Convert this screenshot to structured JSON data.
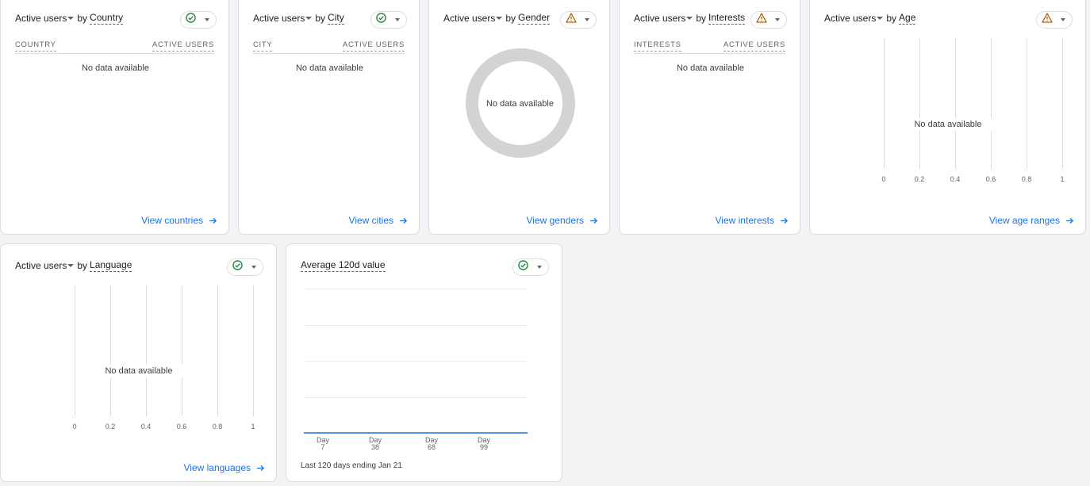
{
  "cards": {
    "country": {
      "metric": "Active users",
      "by": "by",
      "dimension": "Country",
      "status": "ok",
      "col_left": "COUNTRY",
      "col_right": "ACTIVE USERS",
      "empty": "No data available",
      "link": "View countries"
    },
    "city": {
      "metric": "Active users",
      "by": "by",
      "dimension": "City",
      "status": "ok",
      "col_left": "CITY",
      "col_right": "ACTIVE USERS",
      "empty": "No data available",
      "link": "View cities"
    },
    "gender": {
      "metric": "Active users",
      "by": "by",
      "dimension": "Gender",
      "status": "warning",
      "empty": "No data available",
      "link": "View genders"
    },
    "interests": {
      "metric": "Active users",
      "by": "by",
      "dimension": "Interests",
      "status": "warning",
      "col_left": "INTERESTS",
      "col_right": "ACTIVE USERS",
      "empty": "No data available",
      "link": "View interests"
    },
    "age": {
      "metric": "Active users",
      "by": "by",
      "dimension": "Age",
      "status": "warning",
      "empty": "No data available",
      "ticks": [
        "0",
        "0.2",
        "0.4",
        "0.6",
        "0.8",
        "1"
      ],
      "link": "View age ranges"
    },
    "language": {
      "metric": "Active users",
      "by": "by",
      "dimension": "Language",
      "status": "ok",
      "empty": "No data available",
      "ticks": [
        "0",
        "0.2",
        "0.4",
        "0.6",
        "0.8",
        "1"
      ],
      "link": "View languages"
    },
    "avg120": {
      "title": "Average 120d value",
      "status": "ok",
      "footnote": "Last 120 days ending Jan 21"
    }
  },
  "chart_data": {
    "type": "line",
    "title": "Average 120d value",
    "x": [
      "Day 7",
      "Day 38",
      "Day 68",
      "Day 99"
    ],
    "x_ticks": [
      {
        "line1": "Day",
        "line2": "7"
      },
      {
        "line1": "Day",
        "line2": "38"
      },
      {
        "line1": "Day",
        "line2": "68"
      },
      {
        "line1": "Day",
        "line2": "99"
      }
    ],
    "series": [
      {
        "values": [
          0,
          0,
          0,
          0
        ]
      }
    ],
    "grid": true
  },
  "colors": {
    "ok": "#188038",
    "warning": "#b06000",
    "link": "#1a73e8",
    "line": "#1a73e8",
    "donut": "#d3d3d3"
  }
}
